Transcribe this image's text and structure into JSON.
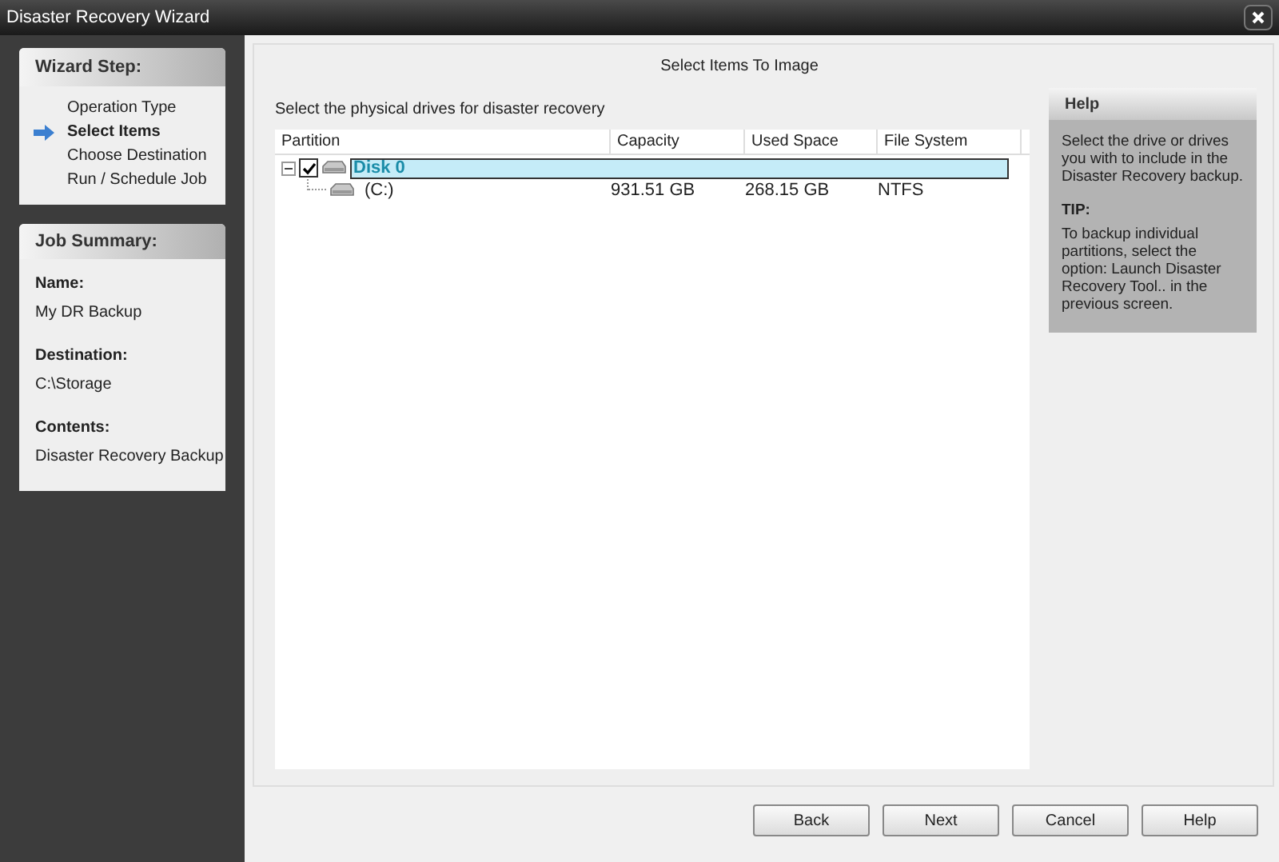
{
  "window": {
    "title": "Disaster Recovery Wizard"
  },
  "wizard_steps": {
    "title": "Wizard Step:",
    "items": [
      {
        "label": "Operation Type",
        "selected": false
      },
      {
        "label": "Select Items",
        "selected": true
      },
      {
        "label": "Choose Destination",
        "selected": false
      },
      {
        "label": "Run / Schedule Job",
        "selected": false
      }
    ]
  },
  "job_summary": {
    "title": "Job Summary:",
    "fields": [
      {
        "label": "Name:",
        "value": "My DR Backup"
      },
      {
        "label": "Destination:",
        "value": "C:\\Storage"
      },
      {
        "label": "Contents:",
        "value": "Disaster Recovery Backup"
      }
    ]
  },
  "page_title": "Select Items To Image",
  "instruction": "Select the physical drives for disaster recovery",
  "table": {
    "columns": [
      "Partition",
      "Capacity",
      "Used Space",
      "File System"
    ],
    "rows": [
      {
        "name": "Disk 0",
        "expanded": true,
        "checked": true,
        "selected": true,
        "cells": [
          "",
          "",
          ""
        ],
        "children": [
          {
            "name": "(C:)",
            "cells": [
              "931.51 GB",
              "268.15 GB",
              "NTFS"
            ]
          }
        ]
      }
    ]
  },
  "help": {
    "title": "Help",
    "text": "Select the drive or drives you with to include in the Disaster Recovery backup.",
    "tip_title": "TIP:",
    "tip": "To backup individual partitions, select the option: Launch Disaster Recovery Tool.. in the previous screen."
  },
  "buttons": [
    "Back",
    "Next",
    "Cancel",
    "Help"
  ]
}
